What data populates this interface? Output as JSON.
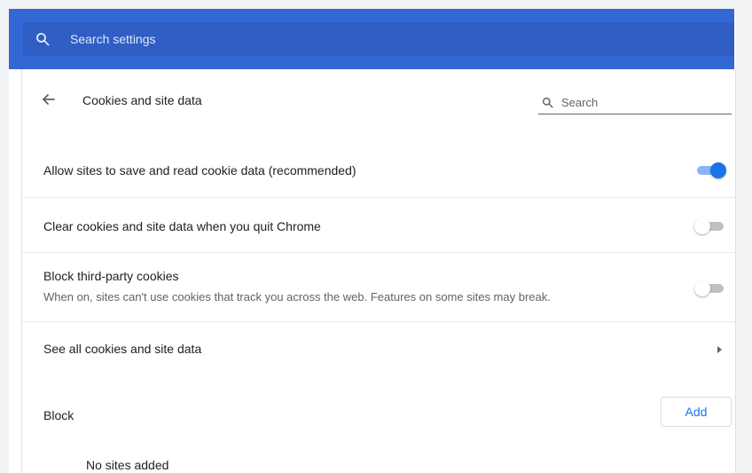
{
  "header": {
    "search_placeholder": "Search settings"
  },
  "subpage": {
    "title": "Cookies and site data",
    "search_placeholder": "Search"
  },
  "settings": {
    "allow_cookies": {
      "label": "Allow sites to save and read cookie data (recommended)",
      "enabled": true
    },
    "clear_on_quit": {
      "label": "Clear cookies and site data when you quit Chrome",
      "enabled": false
    },
    "block_third_party": {
      "label": "Block third-party cookies",
      "sublabel": "When on, sites can't use cookies that track you across the web. Features on some sites may break.",
      "enabled": false
    },
    "see_all": {
      "label": "See all cookies and site data"
    }
  },
  "block_section": {
    "title": "Block",
    "add_label": "Add",
    "empty_text": "No sites added"
  },
  "colors": {
    "header_bg": "#3367d6",
    "accent": "#1a73e8"
  },
  "icons": {
    "search": "search-icon",
    "back": "arrow-back-icon",
    "chevron": "chevron-right-icon"
  }
}
